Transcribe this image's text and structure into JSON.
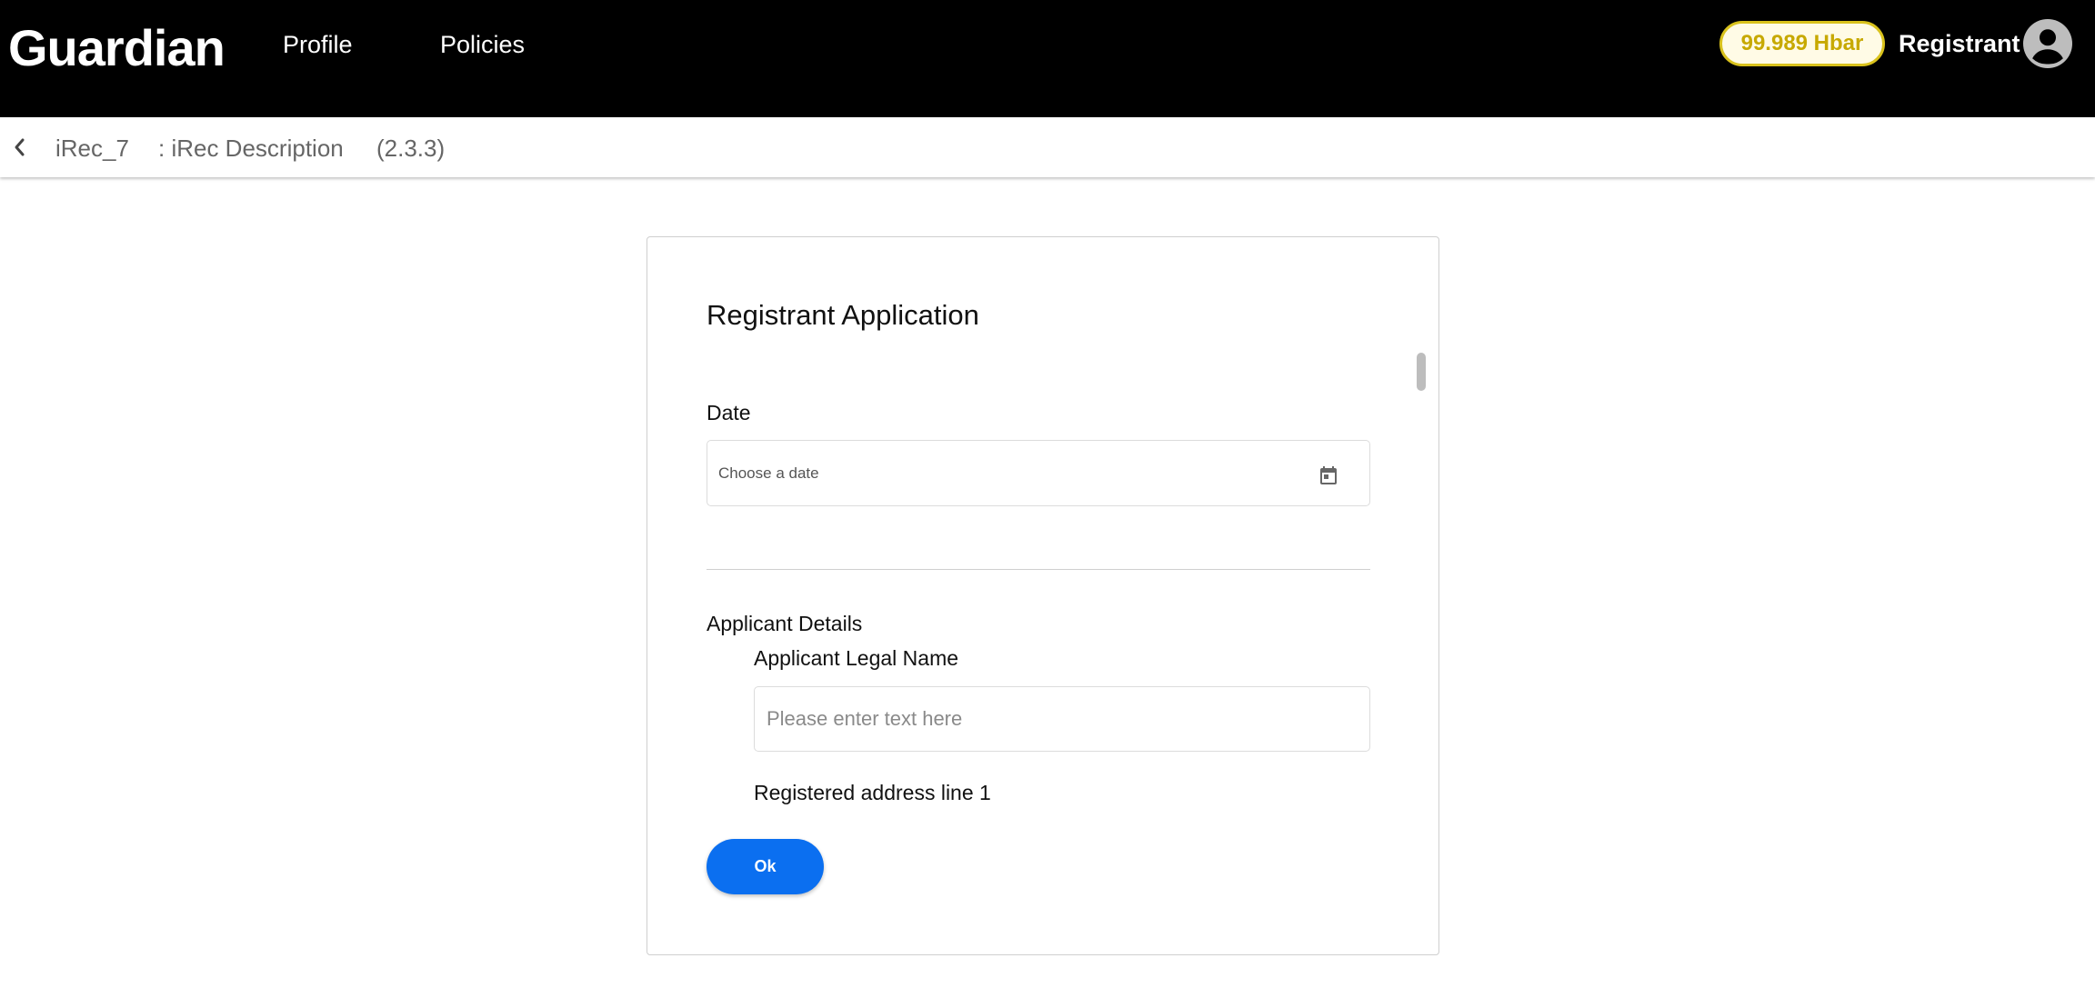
{
  "header": {
    "brand": "Guardian",
    "nav": {
      "profile": "Profile",
      "policies": "Policies"
    },
    "balance": "99.989 Hbar",
    "user_role": "Registrant",
    "avatar_icon": "account-circle-icon"
  },
  "breadcrumb": {
    "back_icon": "chevron-left-icon",
    "policy_name": "iRec_7",
    "policy_description": ": iRec Description",
    "version": "(2.3.3)"
  },
  "dialog": {
    "title": "Registrant Application",
    "date_label": "Date",
    "date_placeholder": "Choose a date",
    "calendar_icon": "calendar-icon",
    "section_title": "Applicant Details",
    "legal_name_label": "Applicant Legal Name",
    "legal_name_placeholder": "Please enter text here",
    "address_label": "Registered address line 1",
    "ok_label": "Ok"
  },
  "colors": {
    "header_bg": "#000000",
    "balance_border": "#d9c21c",
    "balance_text": "#c7a900",
    "primary_button": "#0b6ff0"
  }
}
